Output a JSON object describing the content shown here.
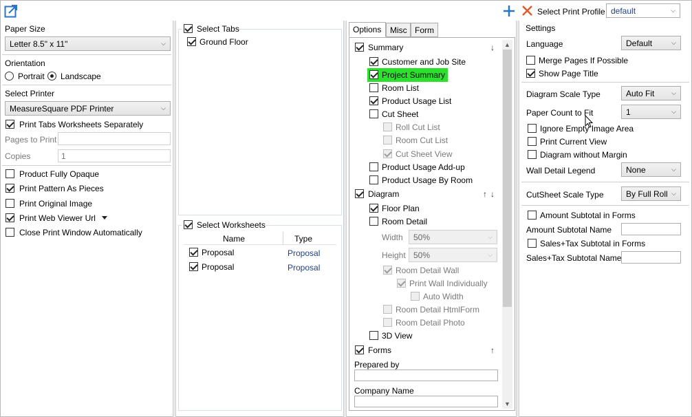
{
  "toolbar": {
    "popout_icon": "popout-icon",
    "add_icon": "plus-icon",
    "remove_icon": "close-icon",
    "select_print_profile_label": "Select Print Profile",
    "profile_value": "default"
  },
  "left": {
    "paper_size_label": "Paper Size",
    "paper_size_value": "Letter 8.5\" x 11\"",
    "orientation_label": "Orientation",
    "portrait_label": "Portrait",
    "landscape_label": "Landscape",
    "select_printer_label": "Select Printer",
    "printer_value": "MeasureSquare PDF Printer",
    "print_tabs_separately": "Print Tabs Worksheets Separately",
    "pages_to_print_label": "Pages to Print",
    "copies_label": "Copies",
    "copies_value": "1",
    "product_fully_opaque": "Product Fully Opaque",
    "print_pattern_as_pieces": "Print Pattern As Pieces",
    "print_original_image": "Print Original Image",
    "print_web_viewer_url": "Print Web Viewer Url",
    "close_print_window": "Close Print Window Automatically"
  },
  "tabs_panel": {
    "select_tabs_label": "Select Tabs",
    "items": [
      "Ground Floor"
    ],
    "select_worksheets_label": "Select Worksheets",
    "col_name": "Name",
    "col_type": "Type",
    "rows": [
      {
        "name": "Proposal",
        "type": "Proposal"
      },
      {
        "name": "Proposal",
        "type": "Proposal"
      }
    ]
  },
  "options": {
    "tabs": [
      "Options",
      "Misc",
      "Form"
    ],
    "summary": "Summary",
    "customer_and_job_site": "Customer and Job Site",
    "project_summary": "Project Summary",
    "room_list": "Room List",
    "product_usage_list": "Product Usage List",
    "cut_sheet": "Cut Sheet",
    "roll_cut_list": "Roll Cut List",
    "room_cut_list": "Room Cut List",
    "cut_sheet_view": "Cut Sheet View",
    "product_usage_add_up": "Product Usage Add-up",
    "product_usage_by_room": "Product Usage By Room",
    "diagram": "Diagram",
    "floor_plan": "Floor Plan",
    "room_detail": "Room Detail",
    "width_label": "Width",
    "width_value": "50%",
    "height_label": "Height",
    "height_value": "50%",
    "room_detail_wall": "Room Detail Wall",
    "print_wall_individually": "Print Wall Individually",
    "auto_width": "Auto Width",
    "room_detail_htmlform": "Room Detail HtmlForm",
    "room_detail_photo": "Room Detail Photo",
    "view_3d": "3D View",
    "forms": "Forms",
    "prepared_by_label": "Prepared by",
    "company_name_label": "Company Name",
    "up_arrow": "↑",
    "down_arrow": "↓"
  },
  "settings": {
    "title": "Settings",
    "language_label": "Language",
    "language_value": "Default",
    "merge_pages": "Merge Pages If Possible",
    "show_page_title": "Show Page Title",
    "diagram_scale_type_label": "Diagram Scale Type",
    "diagram_scale_type_value": "Auto Fit",
    "paper_count_label": "Paper Count to Fit",
    "paper_count_value": "1",
    "ignore_empty_image_area": "Ignore Empty Image Area",
    "print_current_view": "Print Current View",
    "diagram_without_margin": "Diagram without Margin",
    "wall_detail_legend_label": "Wall Detail Legend",
    "wall_detail_legend_value": "None",
    "cutsheet_scale_type_label": "CutSheet Scale Type",
    "cutsheet_scale_type_value": "By Full Roll",
    "amount_subtotal_in_forms": "Amount Subtotal in Forms",
    "amount_subtotal_name_label": "Amount Subtotal Name",
    "sales_tax_subtotal_in_forms": "Sales+Tax Subtotal in Forms",
    "sales_tax_subtotal_name_label": "Sales+Tax Subtotal Name"
  },
  "colors": {
    "accent": "#2a74c8",
    "highlight": "#2ee02e",
    "remove": "#e05a2a"
  }
}
